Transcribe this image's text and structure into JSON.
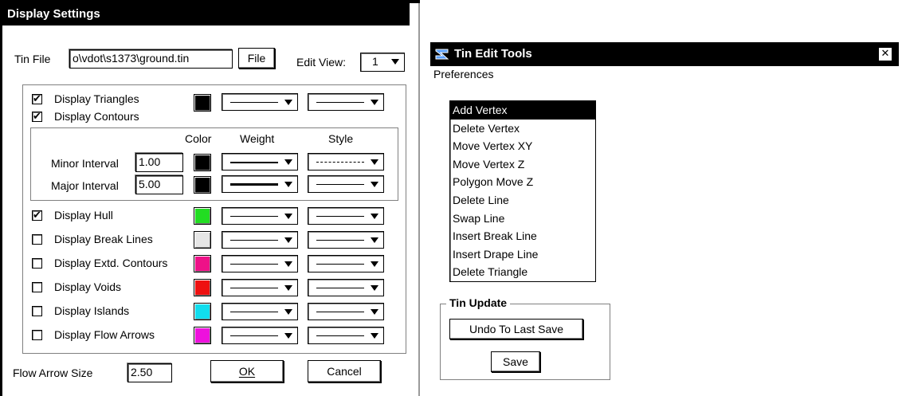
{
  "display_settings": {
    "title": "Display Settings",
    "tin_file_label": "Tin File",
    "tin_file_value": "o\\vdot\\s1373\\ground.tin",
    "file_button": "File",
    "edit_view_label": "Edit View:",
    "edit_view_value": "1",
    "triangles_label": "Display Triangles",
    "contours_label": "Display Contours",
    "col_color": "Color",
    "col_weight": "Weight",
    "col_style": "Style",
    "minor_label": "Minor Interval",
    "minor_value": "1.00",
    "major_label": "Major Interval",
    "major_value": "5.00",
    "layers": [
      {
        "label": "Display Hull",
        "checked": true,
        "color": "#22dd22"
      },
      {
        "label": "Display Break Lines",
        "checked": false,
        "color": "#e6e6e6"
      },
      {
        "label": "Display Extd. Contours",
        "checked": false,
        "color": "#ee1188"
      },
      {
        "label": "Display Voids",
        "checked": false,
        "color": "#ee1111"
      },
      {
        "label": "Display Islands",
        "checked": false,
        "color": "#11ddee"
      },
      {
        "label": "Display Flow Arrows",
        "checked": false,
        "color": "#ee11dd"
      }
    ],
    "triangles_color": "#000000",
    "minor_color": "#000000",
    "major_color": "#000000",
    "flow_arrow_label": "Flow Arrow Size",
    "flow_arrow_value": "2.50",
    "ok_button": "OK",
    "cancel_button": "Cancel",
    "checkmark": "✔"
  },
  "tin_edit_tools": {
    "title": "Tin Edit Tools",
    "menu_preferences": "Preferences",
    "tools": [
      "Add Vertex",
      "Delete Vertex",
      "Move Vertex XY",
      "Move Vertex Z",
      "Polygon Move Z",
      "Delete Line",
      "Swap Line",
      "Insert Break Line",
      "Insert Drape Line",
      "Delete Triangle"
    ],
    "selected_tool": "Add Vertex",
    "tin_update_label": "Tin Update",
    "undo_button": "Undo To Last Save",
    "save_button": "Save",
    "close_glyph": "✕",
    "app_icon": "app-logo-icon"
  }
}
